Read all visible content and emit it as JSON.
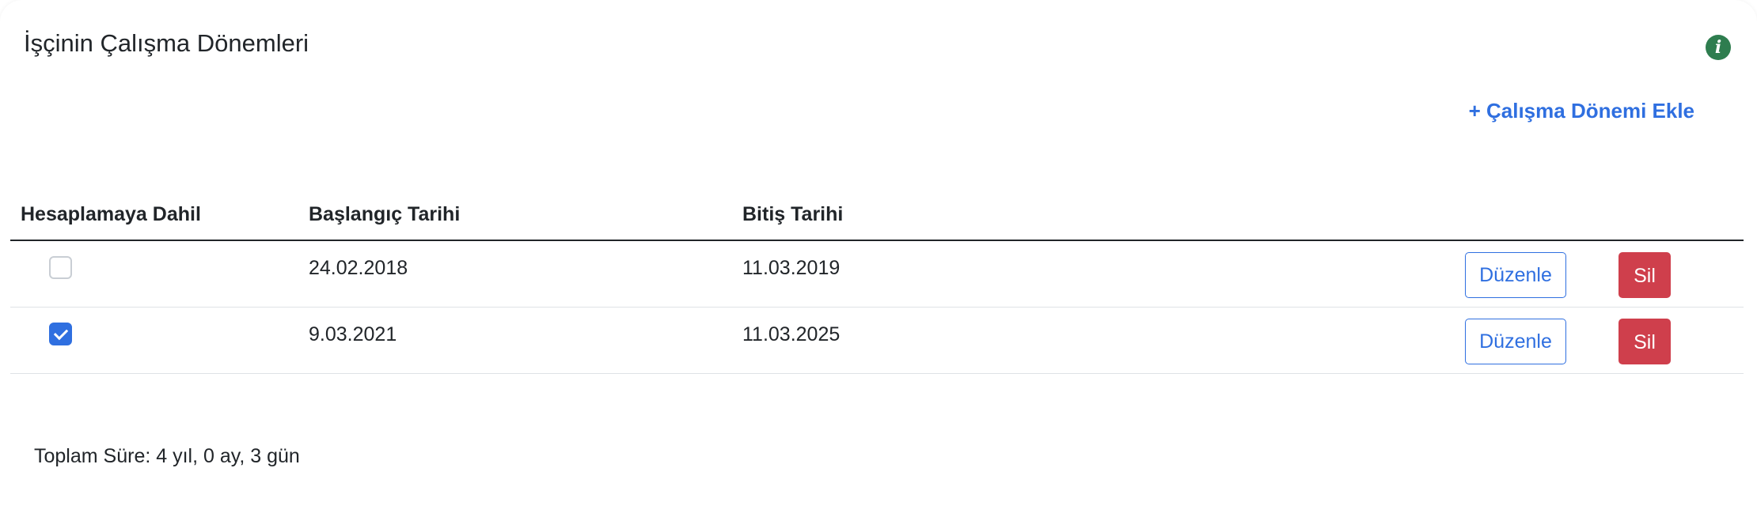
{
  "card": {
    "title": "İşçinin Çalışma Dönemleri",
    "info_icon_glyph": "i",
    "add_link_label": "+ Çalışma Dönemi Ekle"
  },
  "table": {
    "headers": {
      "included": "Hesaplamaya Dahil",
      "start_date": "Başlangıç Tarihi",
      "end_date": "Bitiş Tarihi"
    },
    "rows": [
      {
        "included": false,
        "start_date": "24.02.2018",
        "end_date": "11.03.2019",
        "edit_label": "Düzenle",
        "delete_label": "Sil"
      },
      {
        "included": true,
        "start_date": "9.03.2021",
        "end_date": "11.03.2025",
        "edit_label": "Düzenle",
        "delete_label": "Sil"
      }
    ]
  },
  "summary": {
    "total_text": "Toplam Süre: 4 yıl, 0 ay, 3 gün"
  },
  "colors": {
    "accent": "#2f6fe0",
    "danger": "#cf3f4c",
    "info": "#2e7d4f"
  }
}
